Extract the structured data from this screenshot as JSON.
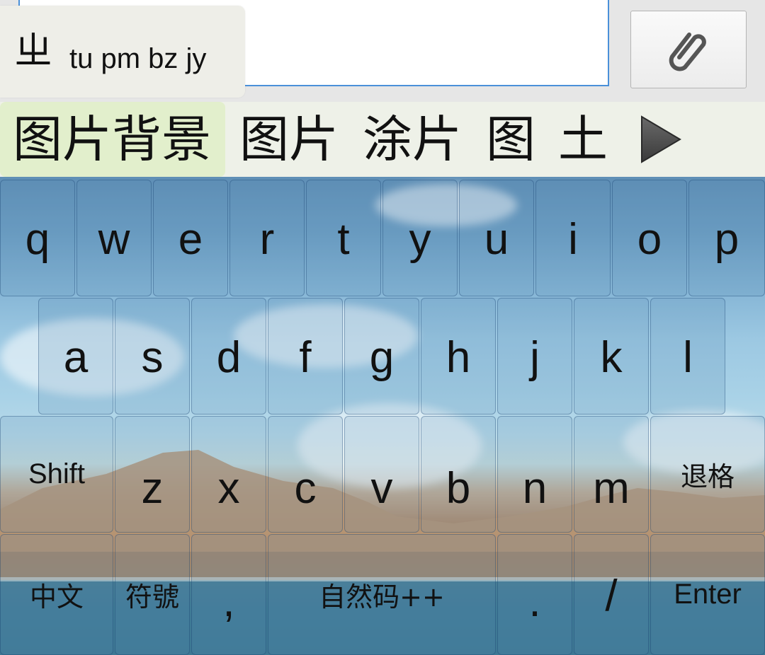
{
  "composition": {
    "zhuyin": "ㄓ",
    "pinyin": "tu pm bz jy"
  },
  "attach_icon": "paperclip-icon",
  "candidates": [
    {
      "text": "图片背景",
      "selected": true
    },
    {
      "text": "图片",
      "selected": false
    },
    {
      "text": "涂片",
      "selected": false
    },
    {
      "text": "图",
      "selected": false
    },
    {
      "text": "土",
      "selected": false
    }
  ],
  "more_icon": "play-triangle-icon",
  "keyboard": {
    "row1": [
      "q",
      "w",
      "e",
      "r",
      "t",
      "y",
      "u",
      "i",
      "o",
      "p"
    ],
    "row2": [
      "a",
      "s",
      "d",
      "f",
      "g",
      "h",
      "j",
      "k",
      "l"
    ],
    "row3": {
      "shift": "Shift",
      "letters": [
        "z",
        "x",
        "c",
        "v",
        "b",
        "n",
        "m"
      ],
      "backspace": "退格"
    },
    "row4": {
      "lang": "中文",
      "symbols": "符號",
      "comma": ",",
      "space": "自然码++",
      "period": ".",
      "slash": "/",
      "enter": "Enter"
    }
  }
}
